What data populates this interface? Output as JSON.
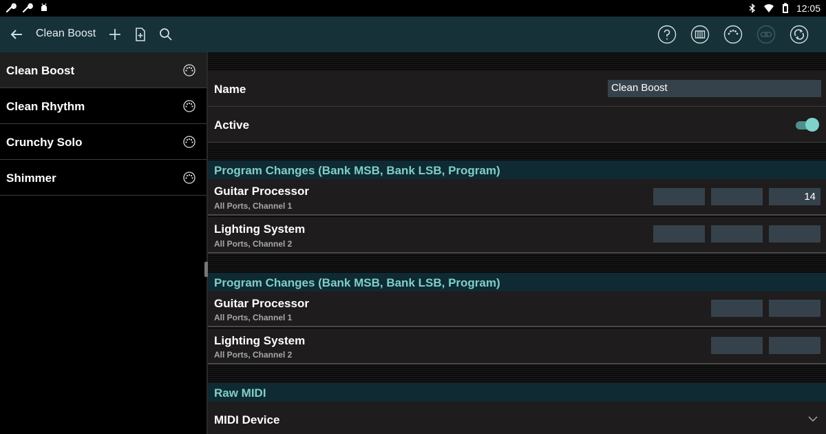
{
  "status_bar": {
    "time": "12:05"
  },
  "app_bar": {
    "title": "Clean Boost"
  },
  "colors": {
    "accent": "#7fd3ca",
    "appbar": "#173139",
    "section_header": "#0f2a33",
    "field": "#36424b"
  },
  "presets": [
    {
      "label": "Clean Boost",
      "selected": true
    },
    {
      "label": "Clean Rhythm",
      "selected": false
    },
    {
      "label": "Crunchy Solo",
      "selected": false
    },
    {
      "label": "Shimmer",
      "selected": false
    }
  ],
  "detail": {
    "name_label": "Name",
    "name_value": "Clean Boost",
    "active_label": "Active",
    "active_on": true,
    "section1": {
      "title": "Program Changes (Bank MSB, Bank LSB, Program)",
      "rows": [
        {
          "label": "Guitar Processor",
          "sub": "All Ports, Channel 1",
          "msb": "",
          "lsb": "",
          "program": "14"
        },
        {
          "label": "Lighting System",
          "sub": "All Ports, Channel 2",
          "msb": "",
          "lsb": "",
          "program": ""
        }
      ]
    },
    "section2": {
      "title": "Program Changes (Bank MSB, Bank LSB, Program)",
      "rows": [
        {
          "label": "Guitar Processor",
          "sub": "All Ports, Channel 1",
          "lsb": "",
          "program": ""
        },
        {
          "label": "Lighting System",
          "sub": "All Ports, Channel 2",
          "lsb": "",
          "program": ""
        }
      ]
    },
    "raw_midi": {
      "title": "Raw MIDI",
      "device_label": "MIDI Device"
    }
  }
}
